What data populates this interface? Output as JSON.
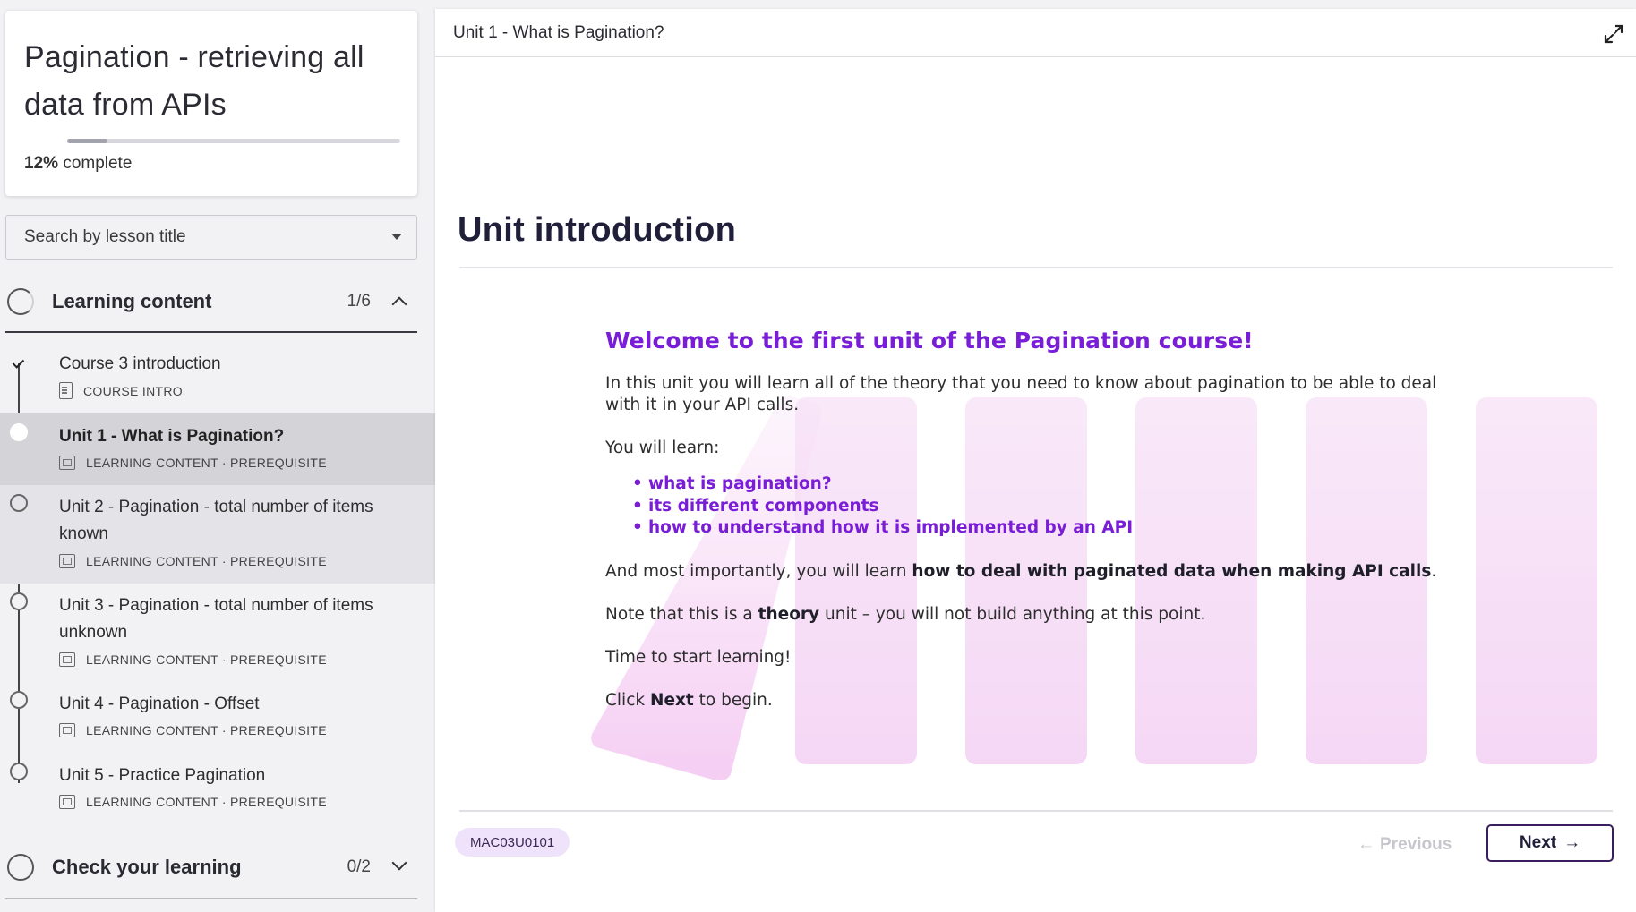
{
  "course": {
    "title": "Pagination - retrieving all data from APIs",
    "progress_percent": "12%",
    "progress_suffix": "complete",
    "progress_value": 0.12
  },
  "search": {
    "placeholder": "Search by lesson title"
  },
  "sections": [
    {
      "title": "Learning content",
      "count": "1/6",
      "expanded": true
    },
    {
      "title": "Check your learning",
      "count": "0/2",
      "expanded": false
    }
  ],
  "lessons": [
    {
      "title": "Course 3 introduction",
      "meta": "COURSE INTRO",
      "icon": "document-icon",
      "state": "done"
    },
    {
      "title": "Unit 1 - What is Pagination?",
      "meta": "LEARNING CONTENT · PREREQUISITE",
      "icon": "slides-icon",
      "state": "current"
    },
    {
      "title": "Unit 2 - Pagination - total number of items known",
      "meta": "LEARNING CONTENT · PREREQUISITE",
      "icon": "slides-icon",
      "state": "todo"
    },
    {
      "title": "Unit 3 - Pagination - total number of items unknown",
      "meta": "LEARNING CONTENT · PREREQUISITE",
      "icon": "slides-icon",
      "state": "todo"
    },
    {
      "title": "Unit 4 - Pagination - Offset",
      "meta": "LEARNING CONTENT · PREREQUISITE",
      "icon": "slides-icon",
      "state": "todo"
    },
    {
      "title": "Unit 5 - Practice Pagination",
      "meta": "LEARNING CONTENT · PREREQUISITE",
      "icon": "slides-icon",
      "state": "todo"
    }
  ],
  "main": {
    "topbar_title": "Unit 1 - What is Pagination?",
    "heading": "Unit introduction",
    "welcome": "Welcome to the first unit of the Pagination course!",
    "intro": "In this unit you will learn all of the theory that you need to know about pagination to be able to deal with it in your API calls.",
    "you_will_learn": "You will learn:",
    "bullets": [
      "what is pagination?",
      "its different components",
      "how to understand how it is implemented by an API"
    ],
    "most_importantly_prefix": "And most importantly, you will learn ",
    "most_importantly_bold": "how to deal with paginated data when making API calls",
    "most_importantly_suffix": ".",
    "note_prefix": "Note that this is a ",
    "note_bold": "theory",
    "note_suffix": " unit – you will not build anything at this point.",
    "time_to_start": "Time to start learning!",
    "click_prefix": "Click ",
    "click_bold": "Next",
    "click_suffix": " to begin.",
    "unit_code": "MAC03U0101",
    "prev_label": "Previous",
    "next_label": "Next"
  },
  "colors": {
    "accent_purple": "#7a1dd6",
    "next_border": "#3a1d5c",
    "code_badge_bg": "#efe2fb"
  }
}
